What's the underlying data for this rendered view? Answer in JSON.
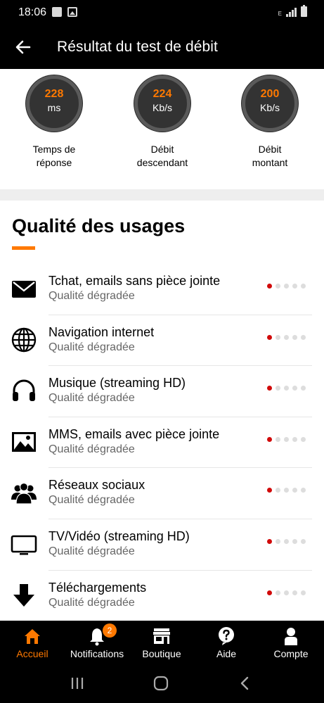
{
  "status_bar": {
    "time": "18:06",
    "network_type": "E"
  },
  "header": {
    "title": "Résultat du test de débit"
  },
  "metrics": [
    {
      "value": "228",
      "unit": "ms",
      "label_line1": "Temps de",
      "label_line2": "réponse"
    },
    {
      "value": "224",
      "unit": "Kb/s",
      "label_line1": "Débit",
      "label_line2": "descendant"
    },
    {
      "value": "200",
      "unit": "Kb/s",
      "label_line1": "Débit",
      "label_line2": "montant"
    }
  ],
  "usages": {
    "title": "Qualité des usages",
    "items": [
      {
        "name": "Tchat, emails sans pièce jointe",
        "quality": "Qualité dégradée",
        "icon": "envelope-icon",
        "level": 1,
        "max": 5
      },
      {
        "name": "Navigation internet",
        "quality": "Qualité dégradée",
        "icon": "globe-icon",
        "level": 1,
        "max": 5
      },
      {
        "name": "Musique (streaming HD)",
        "quality": "Qualité dégradée",
        "icon": "headphones-icon",
        "level": 1,
        "max": 5
      },
      {
        "name": "MMS, emails avec pièce jointe",
        "quality": "Qualité dégradée",
        "icon": "image-icon",
        "level": 1,
        "max": 5
      },
      {
        "name": "Réseaux sociaux",
        "quality": "Qualité dégradée",
        "icon": "people-icon",
        "level": 1,
        "max": 5
      },
      {
        "name": "TV/Vidéo (streaming HD)",
        "quality": "Qualité dégradée",
        "icon": "tv-icon",
        "level": 1,
        "max": 5
      },
      {
        "name": "Téléchargements",
        "quality": "Qualité dégradée",
        "icon": "download-icon",
        "level": 1,
        "max": 5
      }
    ]
  },
  "bottom_nav": {
    "items": [
      {
        "label": "Accueil",
        "icon": "home-icon",
        "active": true
      },
      {
        "label": "Notifications",
        "icon": "bell-icon",
        "badge": "2"
      },
      {
        "label": "Boutique",
        "icon": "shop-icon"
      },
      {
        "label": "Aide",
        "icon": "help-icon"
      },
      {
        "label": "Compte",
        "icon": "account-icon"
      }
    ]
  },
  "colors": {
    "accent": "#ff7900",
    "quality_dot": "#d10a0a",
    "inactive_dot": "#dddddd"
  }
}
